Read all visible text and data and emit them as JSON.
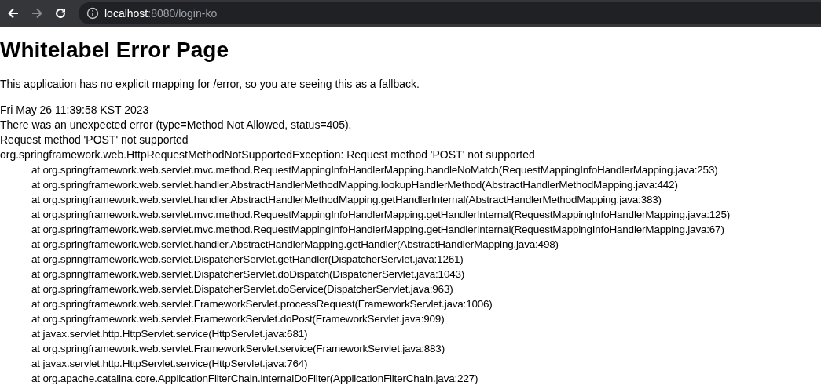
{
  "browser": {
    "address_bar": {
      "host": "localhost",
      "path": ":8080/login-ko"
    }
  },
  "page": {
    "heading": "Whitelabel Error Page",
    "description": "This application has no explicit mapping for /error, so you are seeing this as a fallback.",
    "timestamp": "Fri May 26 11:39:58 KST 2023",
    "error": "There was an unexpected error (type=Method Not Allowed, status=405).",
    "message": "Request method 'POST' not supported",
    "exception": "org.springframework.web.HttpRequestMethodNotSupportedException: Request method 'POST' not supported",
    "frames": [
      "at org.springframework.web.servlet.mvc.method.RequestMappingInfoHandlerMapping.handleNoMatch(RequestMappingInfoHandlerMapping.java:253)",
      "at org.springframework.web.servlet.handler.AbstractHandlerMethodMapping.lookupHandlerMethod(AbstractHandlerMethodMapping.java:442)",
      "at org.springframework.web.servlet.handler.AbstractHandlerMethodMapping.getHandlerInternal(AbstractHandlerMethodMapping.java:383)",
      "at org.springframework.web.servlet.mvc.method.RequestMappingInfoHandlerMapping.getHandlerInternal(RequestMappingInfoHandlerMapping.java:125)",
      "at org.springframework.web.servlet.mvc.method.RequestMappingInfoHandlerMapping.getHandlerInternal(RequestMappingInfoHandlerMapping.java:67)",
      "at org.springframework.web.servlet.handler.AbstractHandlerMapping.getHandler(AbstractHandlerMapping.java:498)",
      "at org.springframework.web.servlet.DispatcherServlet.getHandler(DispatcherServlet.java:1261)",
      "at org.springframework.web.servlet.DispatcherServlet.doDispatch(DispatcherServlet.java:1043)",
      "at org.springframework.web.servlet.DispatcherServlet.doService(DispatcherServlet.java:963)",
      "at org.springframework.web.servlet.FrameworkServlet.processRequest(FrameworkServlet.java:1006)",
      "at org.springframework.web.servlet.FrameworkServlet.doPost(FrameworkServlet.java:909)",
      "at javax.servlet.http.HttpServlet.service(HttpServlet.java:681)",
      "at org.springframework.web.servlet.FrameworkServlet.service(FrameworkServlet.java:883)",
      "at javax.servlet.http.HttpServlet.service(HttpServlet.java:764)",
      "at org.apache.catalina.core.ApplicationFilterChain.internalDoFilter(ApplicationFilterChain.java:227)"
    ]
  }
}
